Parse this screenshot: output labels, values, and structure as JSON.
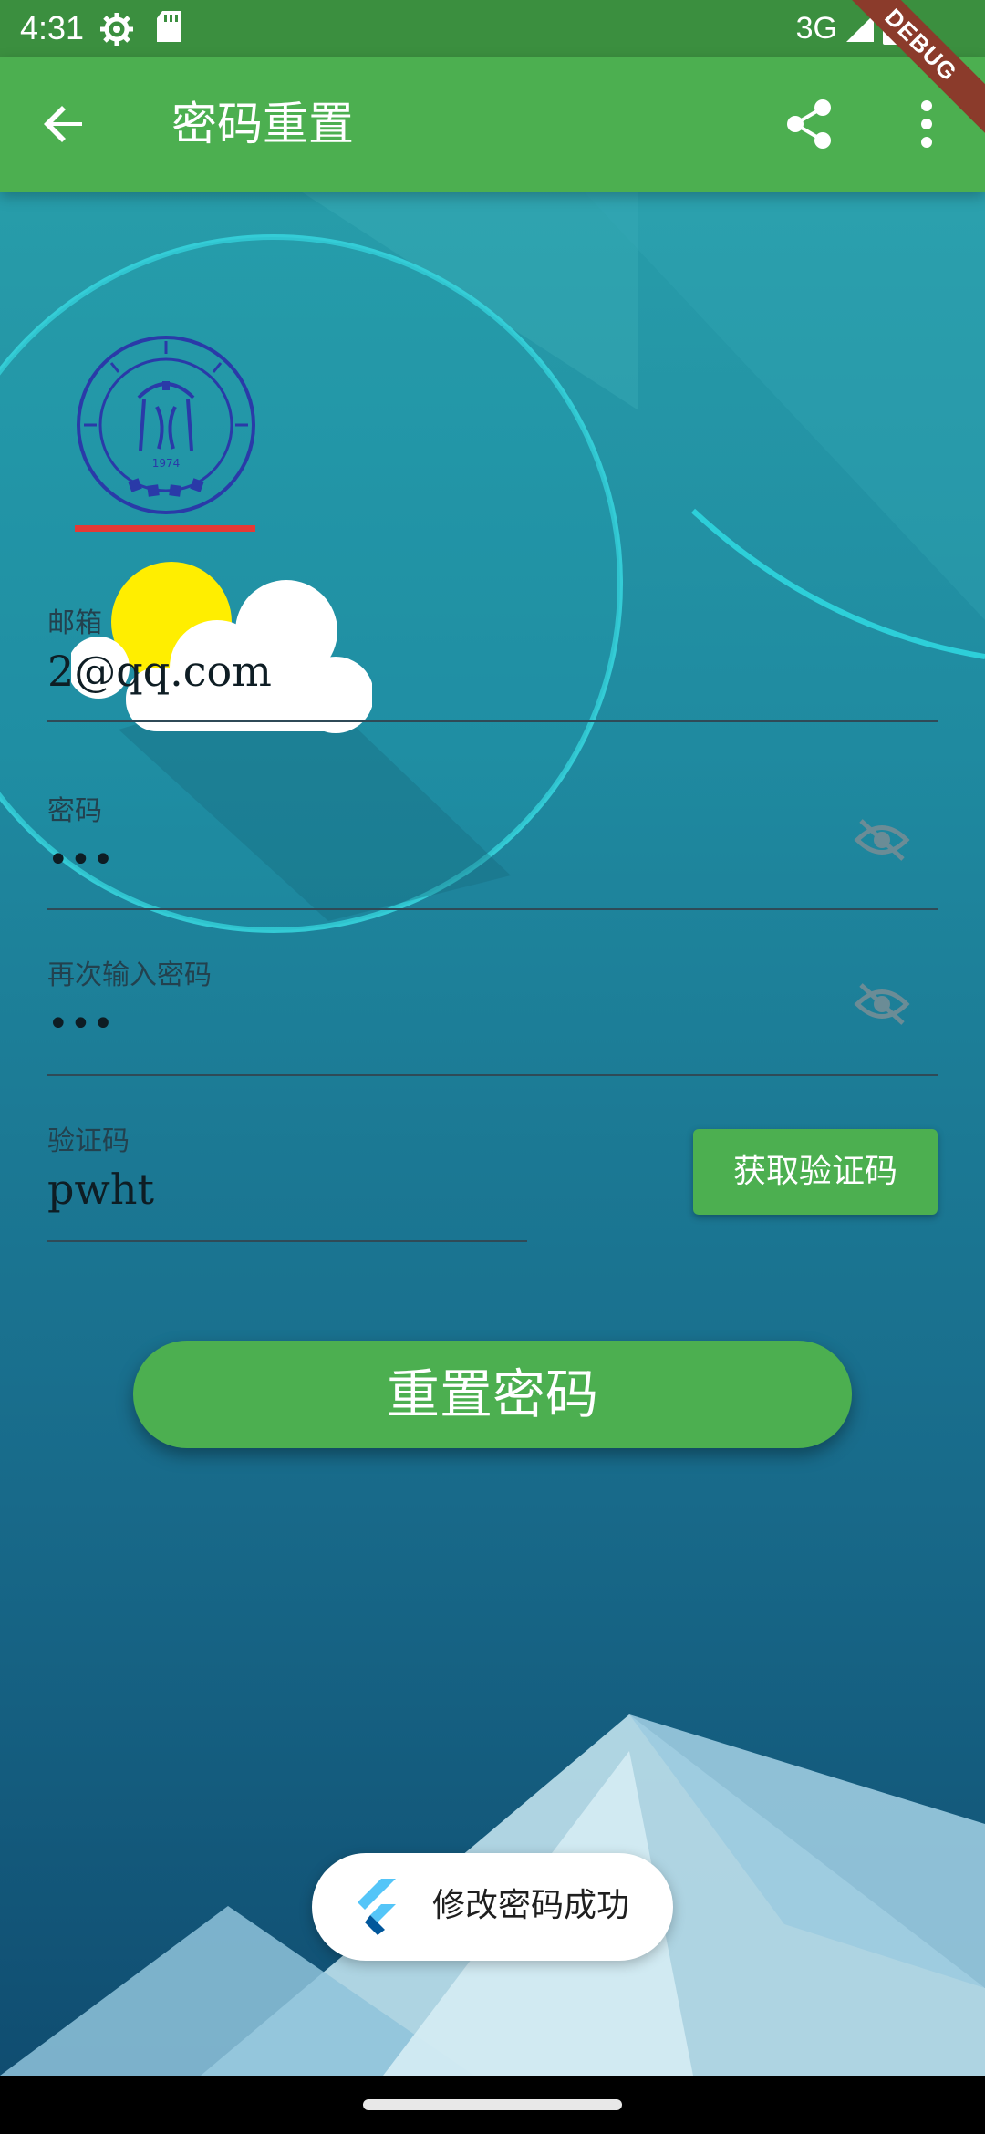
{
  "status_bar": {
    "time": "4:31",
    "network": "3G",
    "icons": [
      "gear-icon",
      "sd-card-icon",
      "signal-icon",
      "battery-icon"
    ]
  },
  "debug_banner": "DEBUG",
  "app_bar": {
    "title": "密码重置",
    "back_icon": "arrow-back-icon",
    "share_icon": "share-icon",
    "more_icon": "more-vert-icon",
    "color": "#4caf50"
  },
  "logo": {
    "alt": "university-seal",
    "year": "1974"
  },
  "form": {
    "email": {
      "label": "邮箱",
      "value": "2@qq.com"
    },
    "password": {
      "label": "密码",
      "value": "•••",
      "toggle_icon": "visibility-off-icon"
    },
    "confirm_password": {
      "label": "再次输入密码",
      "value": "•••",
      "toggle_icon": "visibility-off-icon"
    },
    "verification_code": {
      "label": "验证码",
      "value": "pwht",
      "button_label": "获取验证码"
    },
    "submit_label": "重置密码"
  },
  "toast": {
    "message": "修改密码成功",
    "icon": "flutter-logo-icon"
  },
  "colors": {
    "accent": "#4caf50",
    "status_bar": "#3b8f3f",
    "underline_red": "#e53935",
    "background_top": "#2aa0ad",
    "background_bottom": "#114d70"
  }
}
